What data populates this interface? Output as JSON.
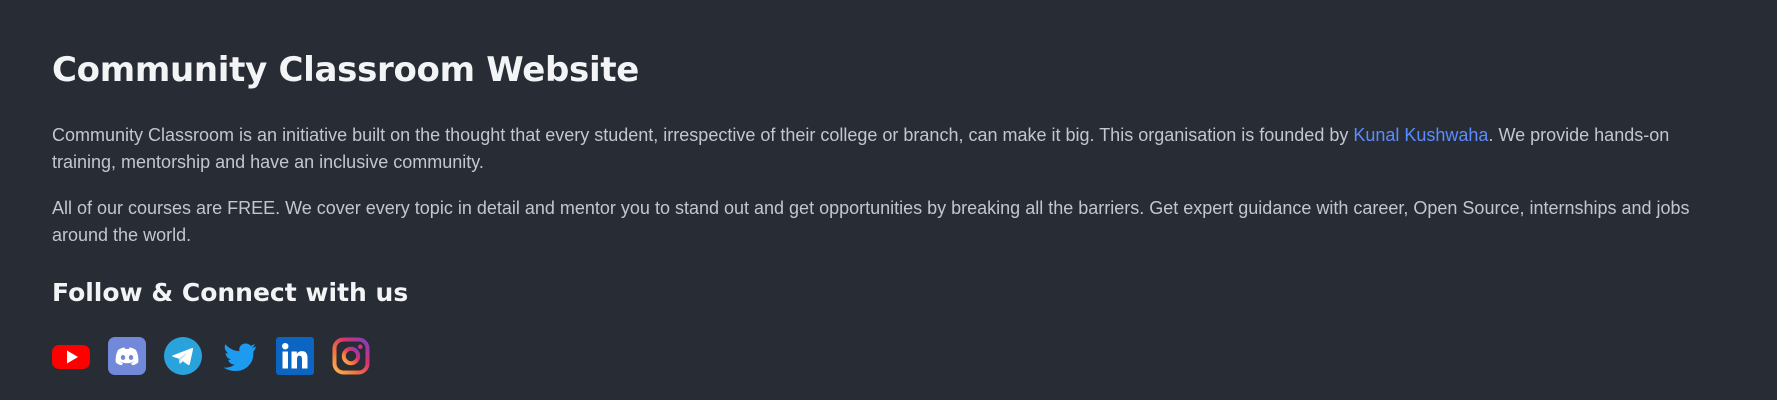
{
  "about": {
    "title": "Community Classroom Website",
    "paragraph1_part1": "Community Classroom is an initiative built on the thought that every student, irrespective of their college or branch, can make it big. This organisation is founded by ",
    "founder_link": "Kunal Kushwaha",
    "paragraph1_part2": ". We provide hands-on training, mentorship and have an inclusive community.",
    "paragraph2": "All of our courses are FREE. We cover every topic in detail and mentor you to stand out and get opportunities by breaking all the barriers. Get expert guidance with career, Open Source, internships and jobs around the world."
  },
  "follow": {
    "heading": "Follow & Connect with us",
    "icons": [
      "youtube-icon",
      "discord-icon",
      "telegram-icon",
      "twitter-icon",
      "linkedin-icon",
      "instagram-icon"
    ]
  },
  "colors": {
    "background": "#282c34",
    "link": "#5b8cff",
    "youtube": "#ff0000",
    "discord": "#7289da",
    "telegram": "#2aa3dd",
    "twitter": "#1d9bf0",
    "linkedin": "#0a66c2"
  }
}
